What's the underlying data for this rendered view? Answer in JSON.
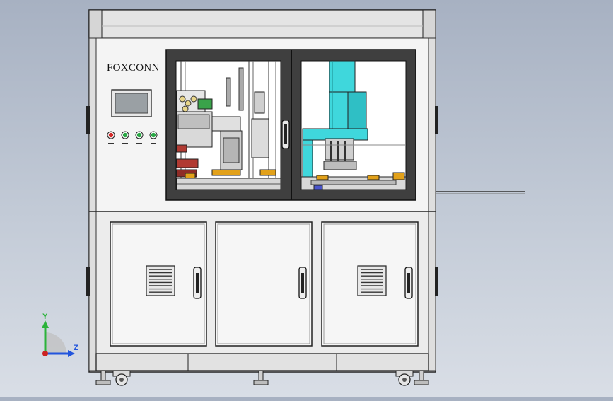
{
  "window": {
    "title": "",
    "background_top": "#a7b1c2",
    "background_bottom": "#d9dee6"
  },
  "machine": {
    "brand_label": "FOXCONN",
    "frame_color": "#ececec",
    "outline_color": "#222222",
    "window_frame_color": "#3f3f3f",
    "glass_color": "#ffffff",
    "accent_cyan": "#3fd7dc",
    "accent_orange": "#e2a11a",
    "accent_red": "#b13a32",
    "indicator_lights": [
      {
        "name": "red-light",
        "color": "#d22a2a"
      },
      {
        "name": "green-light-1",
        "color": "#2aa745"
      },
      {
        "name": "green-light-2",
        "color": "#2aa745"
      },
      {
        "name": "green-light-3",
        "color": "#2aa745"
      }
    ],
    "cabinet_doors": [
      {
        "name": "cabinet-door-left",
        "has_vent": true
      },
      {
        "name": "cabinet-door-middle",
        "has_vent": false
      },
      {
        "name": "cabinet-door-right",
        "has_vent": true
      }
    ]
  },
  "axes": {
    "y_label": "Y",
    "z_label": "Z",
    "y_color": "#2bb33a",
    "z_color": "#2255dd",
    "x_color": "#cc2222"
  }
}
